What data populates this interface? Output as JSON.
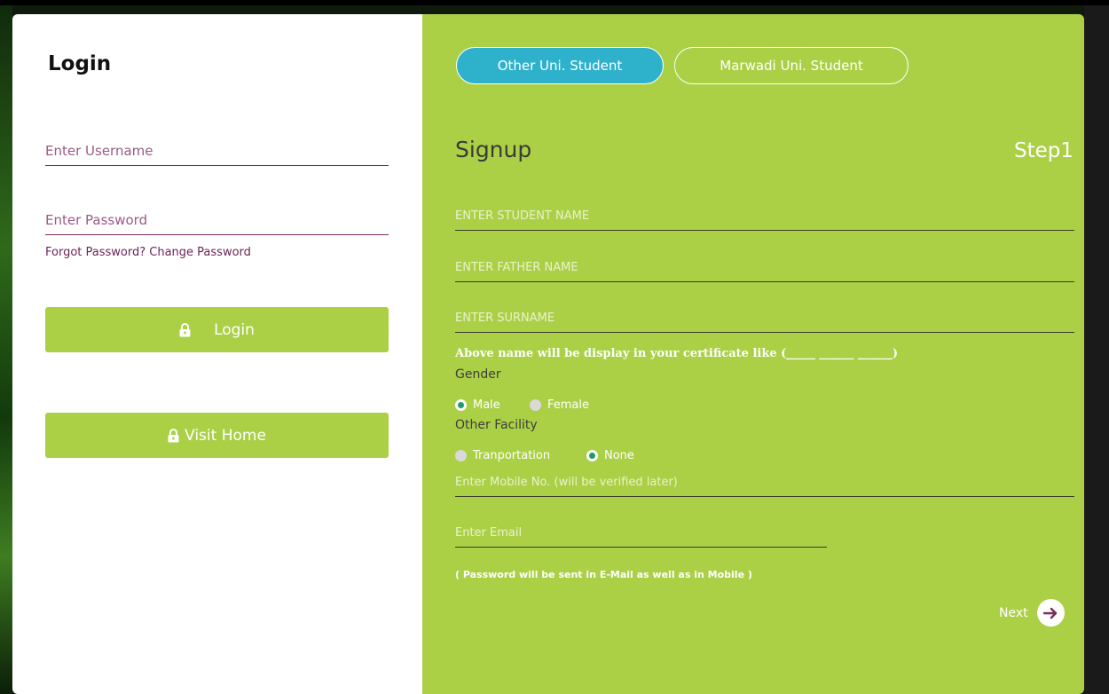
{
  "login": {
    "title": "Login",
    "username_placeholder": "Enter Username",
    "password_placeholder": "Enter Password",
    "forgot_link": "Forgot Password? Change Password",
    "login_button": "Login",
    "visit_home_button": "Visit Home"
  },
  "signup": {
    "tabs": [
      {
        "label": "Other Uni. Student",
        "active": true
      },
      {
        "label": "Marwadi Uni. Student",
        "active": false
      }
    ],
    "title": "Signup",
    "step": "Step1",
    "fields": {
      "student_name_placeholder": "ENTER STUDENT NAME",
      "father_name_placeholder": "ENTER FATHER NAME",
      "surname_placeholder": "ENTER SURNAME",
      "mobile_placeholder": "Enter Mobile No. (will be verified later)",
      "email_placeholder": "Enter Email"
    },
    "certificate_note": "Above name will be display in your certificate like (_____ ______ ______)",
    "gender": {
      "label": "Gender",
      "options": [
        {
          "label": "Male",
          "selected": true
        },
        {
          "label": "Female",
          "selected": false
        }
      ]
    },
    "facility": {
      "label": "Other Facility",
      "options": [
        {
          "label": "Tranportation",
          "selected": false
        },
        {
          "label": "None",
          "selected": true
        }
      ]
    },
    "password_note": "( Password will be sent in E-Mail as well as in Mobile )",
    "next_label": "Next"
  },
  "colors": {
    "panel_green": "#abd046",
    "tab_active": "#2eb2cc",
    "link_purple": "#6b2457",
    "radio_selected": "#1f9a6e"
  }
}
